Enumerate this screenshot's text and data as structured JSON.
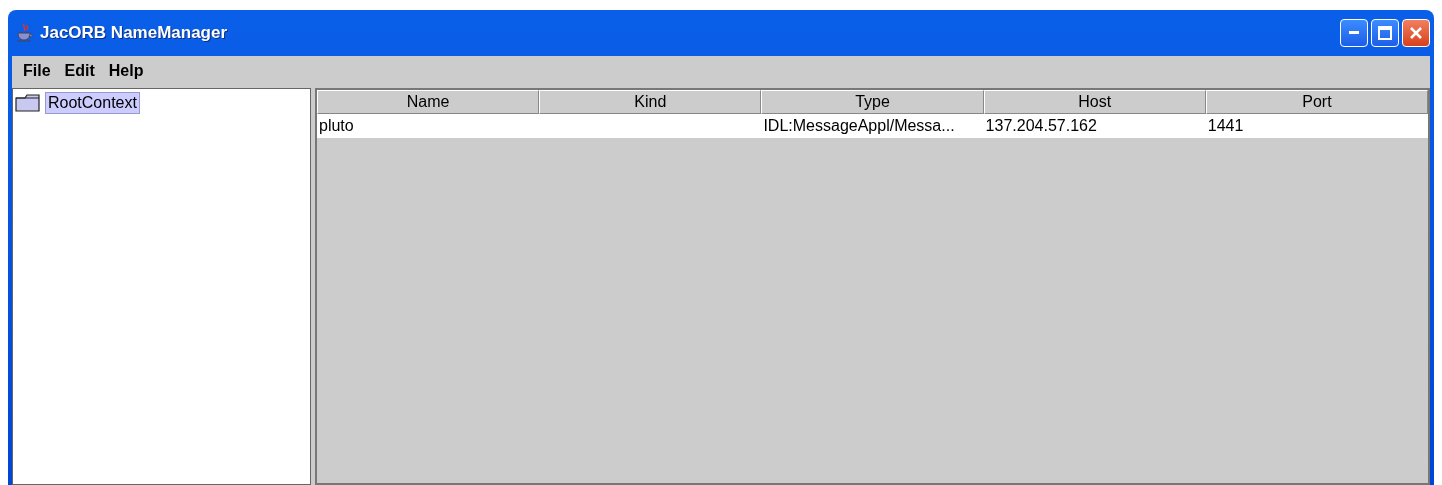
{
  "window": {
    "title": "JacORB NameManager"
  },
  "menu": [
    "File",
    "Edit",
    "Help"
  ],
  "tree": {
    "items": [
      {
        "label": "RootContext",
        "selected": true
      }
    ]
  },
  "table": {
    "columns": [
      "Name",
      "Kind",
      "Type",
      "Host",
      "Port"
    ],
    "rows": [
      {
        "cells": [
          "pluto",
          "",
          "IDL:MessageAppl/Messa...",
          "137.204.57.162",
          "1441"
        ],
        "selected": false
      }
    ]
  }
}
